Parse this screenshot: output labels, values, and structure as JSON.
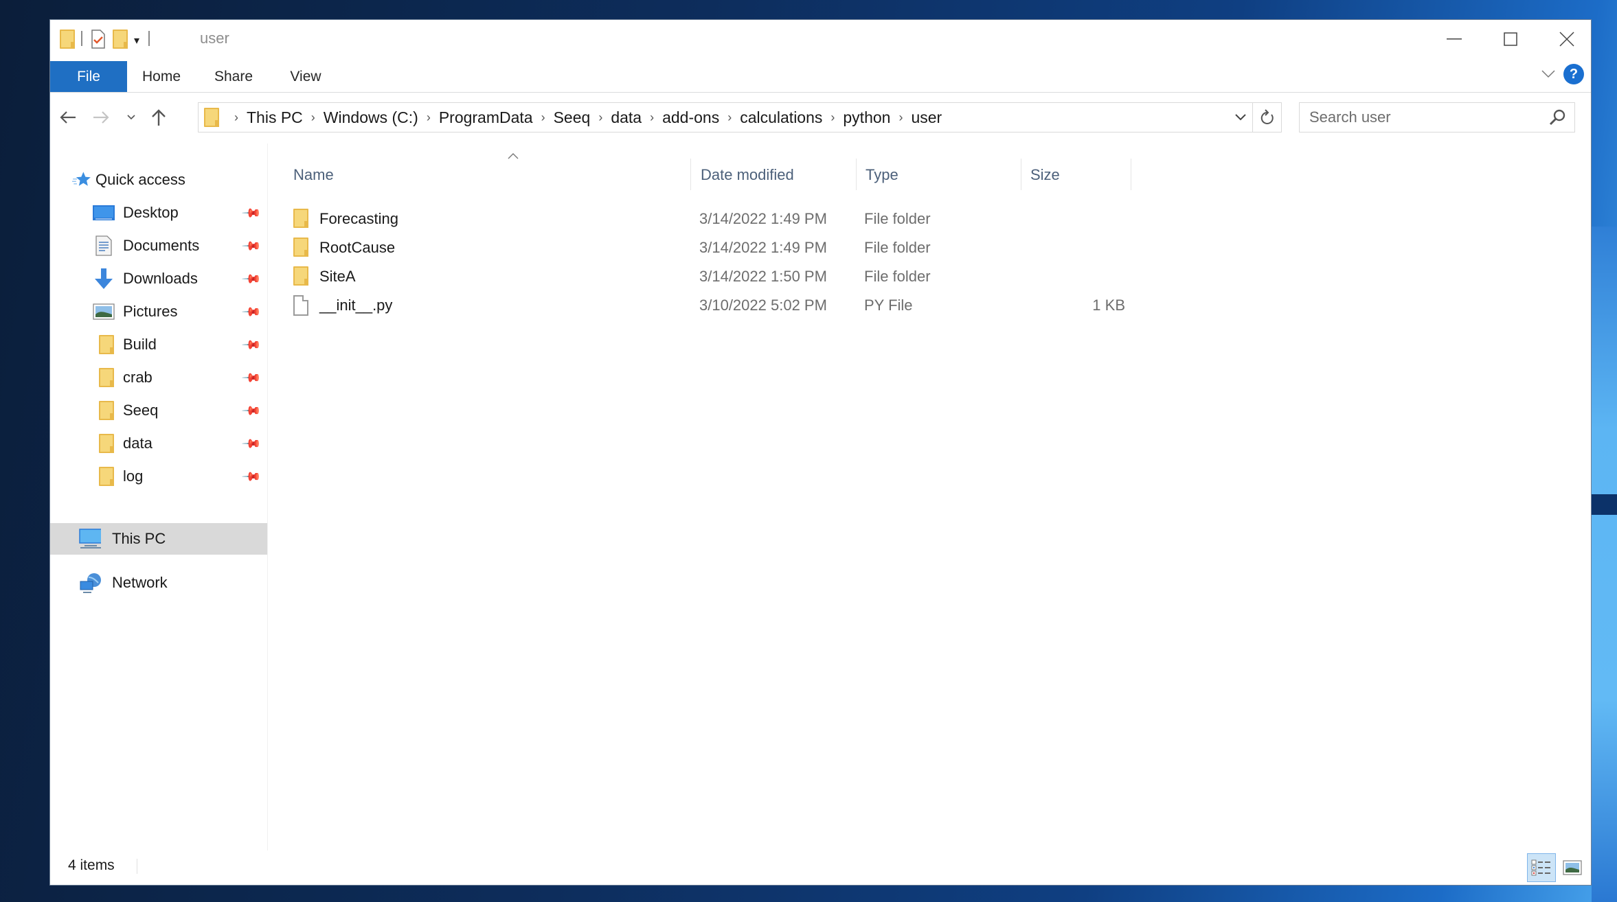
{
  "window": {
    "title": "user",
    "controls": {
      "minimize": "—",
      "maximize": "☐",
      "close": "✕"
    }
  },
  "ribbon": {
    "tabs": [
      {
        "label": "File",
        "active": true
      },
      {
        "label": "Home"
      },
      {
        "label": "Share"
      },
      {
        "label": "View"
      }
    ],
    "help_label": "?"
  },
  "navigation": {
    "back": "←",
    "forward": "→",
    "recent": "⌄",
    "up": "↑",
    "breadcrumb": [
      "This PC",
      "Windows (C:)",
      "ProgramData",
      "Seeq",
      "data",
      "add-ons",
      "calculations",
      "python",
      "user"
    ],
    "separator": "›",
    "refresh": "↻",
    "search": {
      "placeholder": "Search user",
      "value": ""
    }
  },
  "sidebar": {
    "quick_access": {
      "label": "Quick access",
      "icon": "star-icon"
    },
    "pinned": [
      {
        "label": "Desktop",
        "icon": "desktop-icon"
      },
      {
        "label": "Documents",
        "icon": "documents-icon"
      },
      {
        "label": "Downloads",
        "icon": "downloads-icon"
      },
      {
        "label": "Pictures",
        "icon": "pictures-icon"
      },
      {
        "label": "Build",
        "icon": "folder-icon"
      },
      {
        "label": "crab",
        "icon": "folder-icon"
      },
      {
        "label": "Seeq",
        "icon": "folder-icon"
      },
      {
        "label": "data",
        "icon": "folder-icon"
      },
      {
        "label": "log",
        "icon": "folder-icon"
      }
    ],
    "this_pc": {
      "label": "This PC",
      "selected": true
    },
    "network": {
      "label": "Network"
    }
  },
  "file_list": {
    "columns": [
      "Name",
      "Date modified",
      "Type",
      "Size"
    ],
    "sort_column": "Name",
    "rows": [
      {
        "name": "Forecasting",
        "date": "3/14/2022 1:49 PM",
        "type": "File folder",
        "size": "",
        "icon": "folder-icon"
      },
      {
        "name": "RootCause",
        "date": "3/14/2022 1:49 PM",
        "type": "File folder",
        "size": "",
        "icon": "folder-icon"
      },
      {
        "name": "SiteA",
        "date": "3/14/2022 1:50 PM",
        "type": "File folder",
        "size": "",
        "icon": "folder-icon"
      },
      {
        "name": "__init__.py",
        "date": "3/10/2022 5:02 PM",
        "type": "PY File",
        "size": "1 KB",
        "icon": "file-icon"
      }
    ]
  },
  "status_bar": {
    "item_count": "4 items",
    "view_mode": "details"
  },
  "colors": {
    "accent": "#1f6fc3",
    "selection": "#d9d9d9",
    "folder": "#f6d77a",
    "column_header_text": "#4c607a"
  }
}
